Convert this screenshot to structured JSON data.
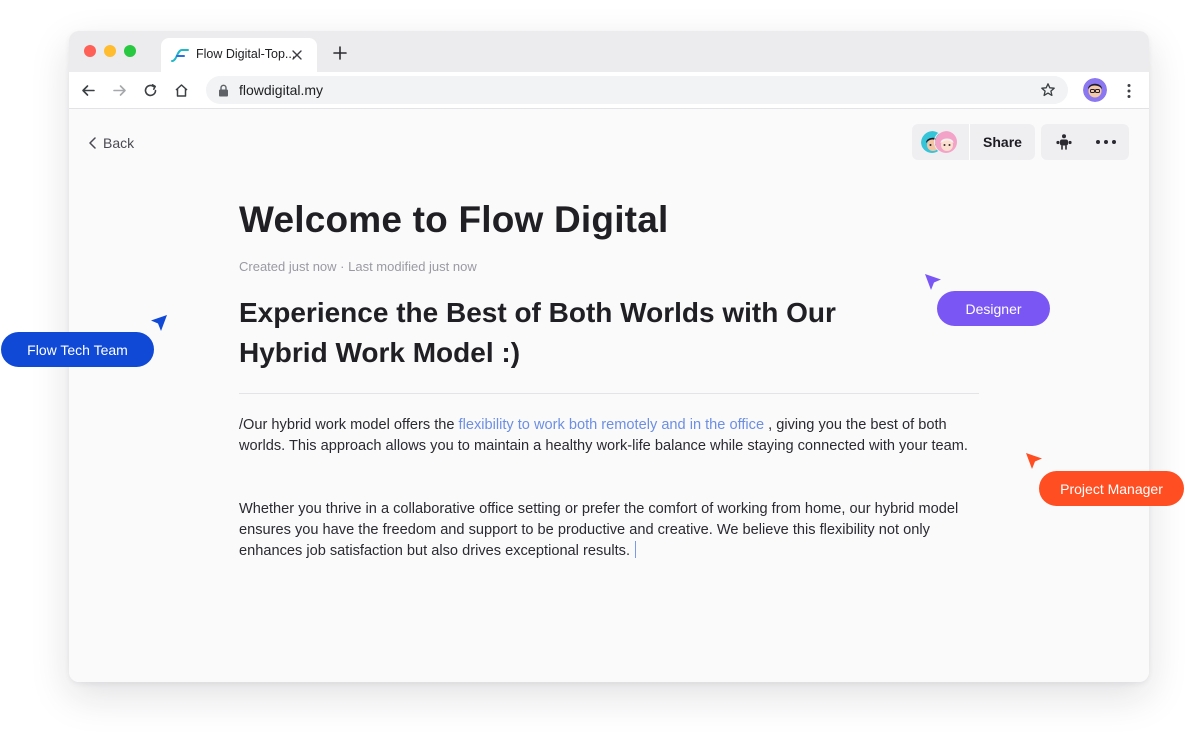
{
  "browser": {
    "tab": {
      "title": "Flow Digital-Top..."
    },
    "url": "flowdigital.my"
  },
  "page": {
    "back_label": "Back",
    "share_label": "Share",
    "title": "Welcome to Flow Digital",
    "meta": "Created just now · Last modified just now",
    "subtitle": "Experience the Best of Both Worlds with Our Hybrid Work Model :)",
    "paragraph1": {
      "before": "/Our hybrid work model offers the ",
      "link": "flexibility to work both remotely and in the office",
      "after": " , giving you the best of both worlds. This approach allows you to maintain a healthy work-life balance while staying connected with your team."
    },
    "paragraph2": "Whether you thrive in a collaborative office setting or prefer the comfort of working from home, our hybrid model ensures you have the freedom and support to be productive and creative. We believe this flexibility not only enhances job satisfaction but also drives exceptional results."
  },
  "collaborators": [
    {
      "label": "Flow Tech Team",
      "color": "#0f49d6"
    },
    {
      "label": "Designer",
      "color": "#7a57f4"
    },
    {
      "label": "Project Manager",
      "color": "#ff4e22"
    }
  ],
  "icons": [
    "flow-logo-icon",
    "close-icon",
    "plus-icon",
    "back-arrow-icon",
    "forward-arrow-icon",
    "reload-icon",
    "home-icon",
    "lock-icon",
    "star-icon",
    "kebab-icon",
    "chevron-left-icon",
    "bot-icon",
    "more-icon",
    "cursor-icon"
  ],
  "colors": {
    "accent_link": "#6c8fe3",
    "window_bg": "#fafafb"
  }
}
